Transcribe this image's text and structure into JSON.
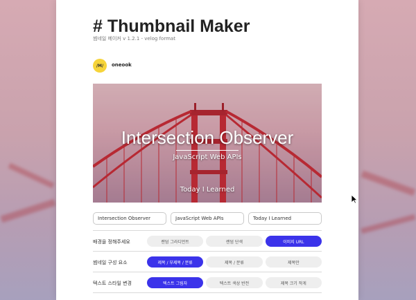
{
  "app": {
    "title": "# Thumbnail Maker",
    "subtitle": "썸네일 메이커 v 1.2.1 - velog format"
  },
  "profile": {
    "avatar_text": "/M/",
    "username": "oneook"
  },
  "preview": {
    "title": "Intersection Observer",
    "subtitle": "JavaScript Web APIs",
    "footer": "Today I Learned"
  },
  "inputs": {
    "title_value": "Intersection Observer",
    "subtitle_value": "JavaScript Web APIs",
    "footer_value": "Today I Learned"
  },
  "settings": [
    {
      "label": "배경을 정해주세요",
      "options": [
        "랜덤 그라디언트",
        "랜덤 단색",
        "이미지 URL"
      ],
      "active": 2
    },
    {
      "label": "썸네일 구성 요소",
      "options": [
        "제목 / 부제목 / 분류",
        "제목 / 분류",
        "제목만"
      ],
      "active": 0
    },
    {
      "label": "텍스트 스타일 변경",
      "options": [
        "텍스트 그림자",
        "텍스트 색상 반전",
        "제목 크기 작게"
      ],
      "active": 0
    }
  ],
  "colors": {
    "accent": "#3b33ea",
    "avatar_bg": "#f6d43a",
    "bridge": "#c82a32"
  }
}
